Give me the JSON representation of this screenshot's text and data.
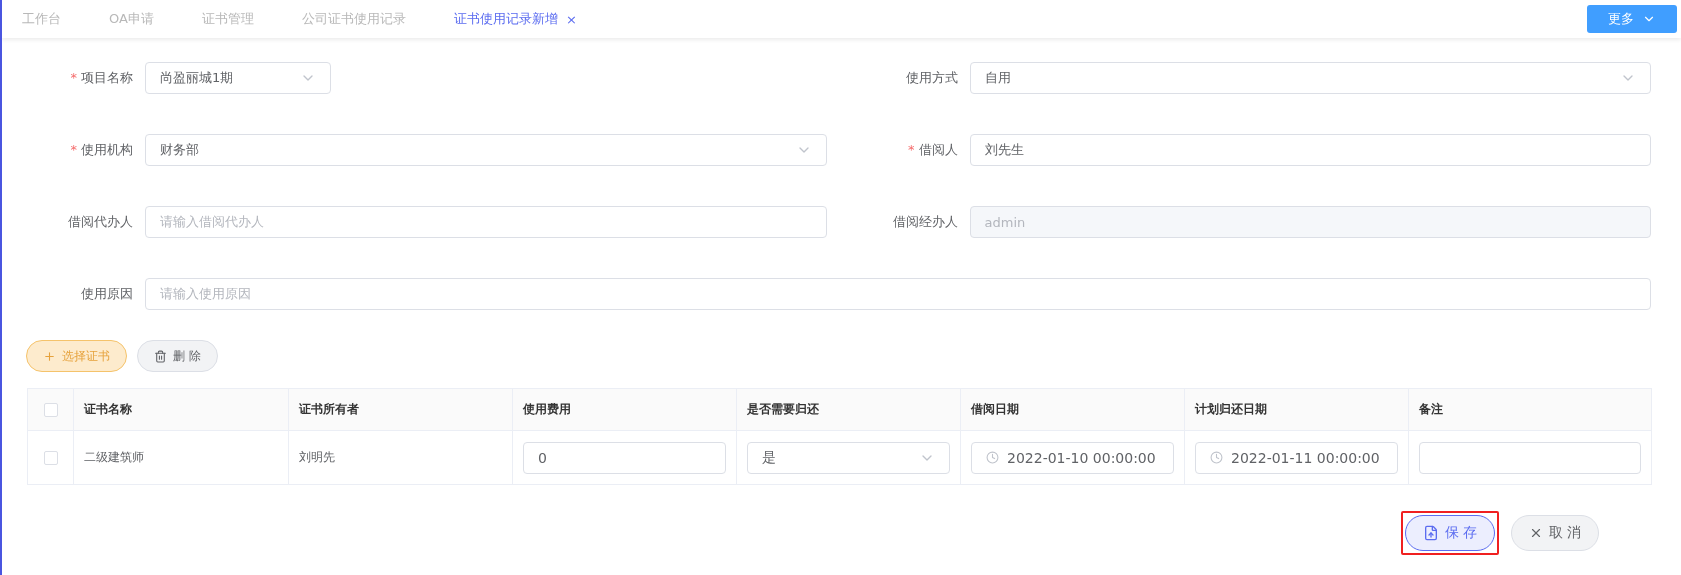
{
  "tabs": [
    {
      "label": "工作台",
      "selected": false
    },
    {
      "label": "OA申请",
      "selected": false
    },
    {
      "label": "证书管理",
      "selected": false
    },
    {
      "label": "公司证书使用记录",
      "selected": false
    },
    {
      "label": "证书使用记录新增",
      "selected": true,
      "close": "×"
    }
  ],
  "more_button": "更多",
  "form": {
    "rows": [
      [
        {
          "label": "项目名称",
          "required_mark": "*",
          "kind": "select",
          "value": "尚盈丽城1期"
        },
        {
          "label": "使用方式",
          "kind": "select",
          "value": "自用"
        }
      ],
      [
        {
          "label": "使用机构",
          "required_mark": "*",
          "kind": "select",
          "value": "财务部"
        },
        {
          "label": "借阅人",
          "required_mark": "*",
          "kind": "input",
          "value": "刘先生"
        }
      ],
      [
        {
          "label": "借阅代办人",
          "kind": "input",
          "placeholder": "请输入借阅代办人"
        },
        {
          "label": "借阅经办人",
          "kind": "input",
          "value": "admin",
          "disabled": true
        }
      ],
      [
        {
          "label": "使用原因",
          "kind": "input",
          "placeholder": "请输入使用原因"
        }
      ]
    ]
  },
  "actions": [
    {
      "label": "选择证书",
      "kind": "add"
    },
    {
      "label": "删 除",
      "kind": "delete"
    }
  ],
  "table": {
    "header_checked": false,
    "columns": [
      "证书名称",
      "证书所有者",
      "使用费用",
      "是否需要归还",
      "借阅日期",
      "计划归还日期",
      "备注"
    ],
    "rows": [
      {
        "checked": false,
        "cells": [
          {
            "kind": "text",
            "value": "二级建筑师"
          },
          {
            "kind": "text",
            "value": "刘明先"
          },
          {
            "kind": "input",
            "value": "0"
          },
          {
            "kind": "select",
            "value": "是"
          },
          {
            "kind": "date",
            "value": "2022-01-10 00:00:00"
          },
          {
            "kind": "date",
            "value": "2022-01-11 00:00:00"
          },
          {
            "kind": "input"
          }
        ]
      }
    ]
  },
  "footer": [
    {
      "label": "保 存",
      "kind": "save",
      "highlighted": true
    },
    {
      "label": "取 消",
      "kind": "cancel",
      "highlighted": false
    }
  ]
}
